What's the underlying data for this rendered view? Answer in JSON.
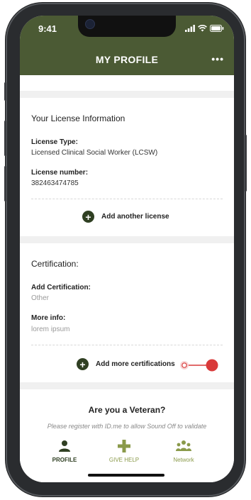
{
  "status_bar": {
    "time": "9:41"
  },
  "header": {
    "title": "MY PROFILE",
    "menu_icon": "more-dots-icon"
  },
  "license": {
    "heading": "Your License Information",
    "type_label": "License Type:",
    "type_value": "Licensed Clinical Social Worker (LCSW)",
    "number_label": "License number:",
    "number_value": "382463474785",
    "add_label": "Add another license"
  },
  "certification": {
    "heading": "Certification:",
    "add_cert_label": "Add Certification:",
    "add_cert_value": "Other",
    "more_info_label": "More info:",
    "more_info_value": "lorem ipsum",
    "add_more_label": "Add more certifications"
  },
  "veteran": {
    "heading": "Are you a Veteran?",
    "text": "Please register with ID.me to allow Sound Off to validate"
  },
  "tabbar": {
    "items": [
      {
        "label": "PROFILE",
        "icon": "person-icon",
        "color": "#2f3f22"
      },
      {
        "label": "GIVE HELP",
        "icon": "plus-cross-icon",
        "color": "#8a9a4a"
      },
      {
        "label": "Network",
        "icon": "group-icon",
        "color": "#8a9a4a"
      }
    ]
  },
  "colors": {
    "header": "#4b5a34",
    "accent_dark": "#2f3f22",
    "accent_light": "#8a9a4a",
    "slider_red": "#d93a3a"
  }
}
